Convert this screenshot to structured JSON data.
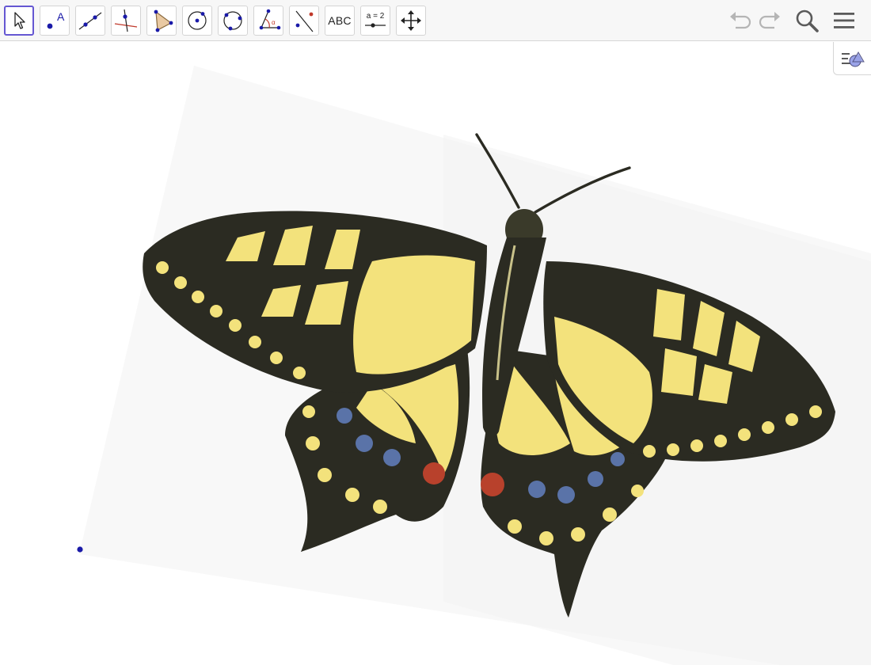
{
  "toolbar": {
    "tools": [
      {
        "id": "move",
        "icon": "move-cursor-icon",
        "selected": true
      },
      {
        "id": "point",
        "icon": "point-icon",
        "label": "A"
      },
      {
        "id": "line",
        "icon": "line-through-two-points-icon"
      },
      {
        "id": "perpendicular",
        "icon": "perpendicular-line-icon"
      },
      {
        "id": "polygon",
        "icon": "polygon-icon"
      },
      {
        "id": "circle",
        "icon": "circle-center-point-icon"
      },
      {
        "id": "circle-three-points",
        "icon": "circle-three-points-icon"
      },
      {
        "id": "angle",
        "icon": "angle-icon",
        "label": "α"
      },
      {
        "id": "reflect",
        "icon": "reflect-about-line-icon"
      },
      {
        "id": "text",
        "icon": "text-icon",
        "label": "ABC"
      },
      {
        "id": "slider",
        "icon": "slider-icon",
        "label": "a = 2"
      },
      {
        "id": "move-graphics",
        "icon": "move-graphics-view-icon"
      }
    ],
    "undo_icon": "undo-icon",
    "redo_icon": "redo-icon",
    "search_icon": "search-icon",
    "menu_icon": "hamburger-menu-icon"
  },
  "style_bar_toggle_icon": "style-bar-toggle-icon",
  "graphics_view": {
    "image": "swallowtail-butterfly-image",
    "point": "free-point"
  },
  "colors": {
    "accent": "#6557d2",
    "point": "#1a1aa8",
    "wing_yellow": "#f3e27c",
    "wing_dark": "#2b2b22",
    "spot_blue": "#5a73a8",
    "spot_red": "#b8412c"
  }
}
